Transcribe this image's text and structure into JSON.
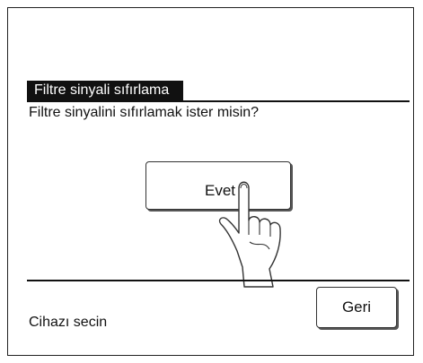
{
  "screen": {
    "title": "Filtre sinyali sıfırlama",
    "question": "Filtre sinyalini sıfırlamak ister misin?",
    "confirm_label": "Evet",
    "back_label": "Geri",
    "status": "Cihazı secin"
  },
  "icons": {
    "pointer": "pointing-hand-icon"
  }
}
